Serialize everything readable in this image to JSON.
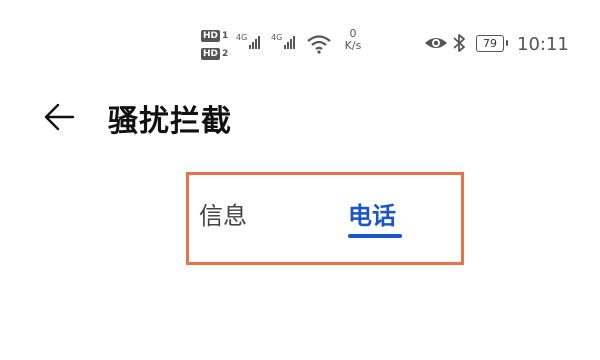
{
  "status_bar": {
    "hd1": "HD",
    "hd1_num": "1",
    "hd2": "HD",
    "hd2_num": "2",
    "sim1_network": "4G",
    "sim2_network": "4G",
    "data_speed_value": "0",
    "data_speed_unit": "K/s",
    "battery_level": "79",
    "time": "10:11",
    "icons": [
      "signal-icon",
      "wifi-icon",
      "eye-icon",
      "bluetooth-icon",
      "battery-icon"
    ]
  },
  "header": {
    "back_icon": "arrow-left-icon",
    "title": "骚扰拦截"
  },
  "tabs": {
    "items": [
      {
        "label": "信息",
        "selected": false
      },
      {
        "label": "电话",
        "selected": true
      }
    ],
    "accent_color": "#1a56c8"
  },
  "annotation": {
    "highlight_color": "#e8734a"
  }
}
